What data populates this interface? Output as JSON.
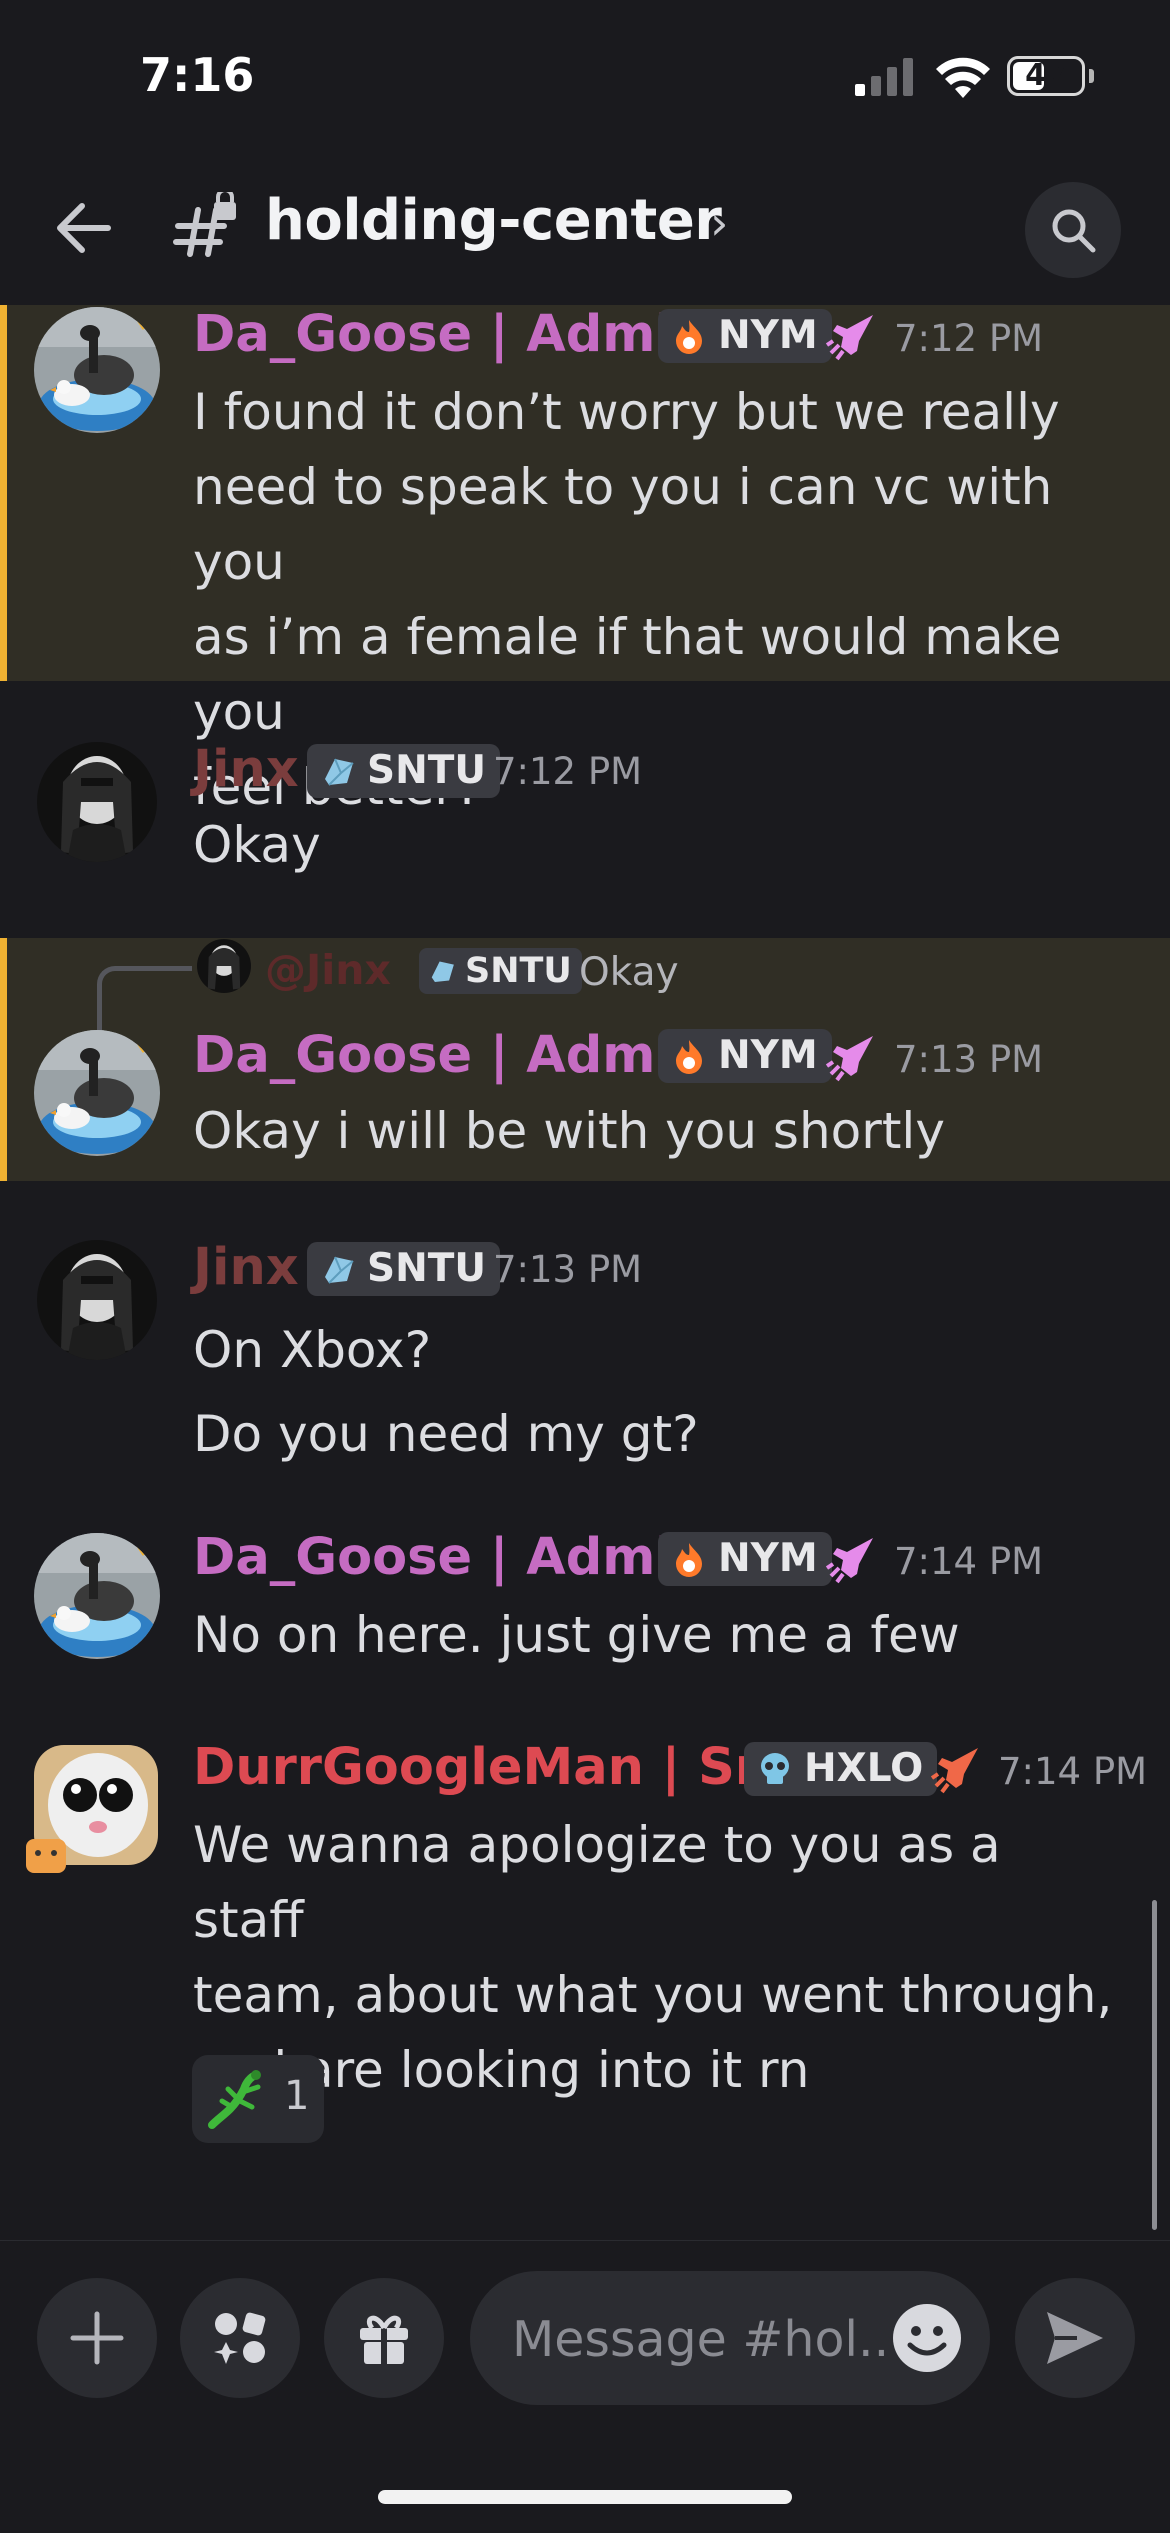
{
  "status_bar": {
    "time": "7:16",
    "battery": "47",
    "battery_level": 0.47
  },
  "header": {
    "channel": "holding-center",
    "chevron": "›"
  },
  "messages": [
    {
      "username": "Da_Goose | Admin",
      "tag": "NYM",
      "time": "7:12 PM",
      "lines": [
        "I found it don’t worry but we really",
        "need to speak to you i can vc with you",
        "as i’m a female if that would make you",
        "feel better?"
      ]
    },
    {
      "username": "Jinx",
      "tag": "SNTU",
      "time": "7:12 PM",
      "lines": [
        "Okay"
      ]
    },
    {
      "reply": {
        "username": "@Jinx",
        "tag": "SNTU",
        "text": "Okay"
      },
      "username": "Da_Goose | Admin",
      "tag": "NYM",
      "time": "7:13 PM",
      "lines": [
        "Okay i will be with you shortly"
      ]
    },
    {
      "username": "Jinx",
      "tag": "SNTU",
      "time": "7:13 PM",
      "lines": [
        "On Xbox?",
        "Do you need my gt?"
      ]
    },
    {
      "username": "Da_Goose | Admin",
      "tag": "NYM",
      "time": "7:14 PM",
      "lines": [
        "No on here. just give me a few"
      ]
    },
    {
      "username": "DurrGoogleMan | Sr...",
      "tag": "HXLO",
      "time": "7:14 PM",
      "lines": [
        "We wanna apologize to you as a staff",
        "team, about what you went through,",
        "and are looking into it rn"
      ],
      "reaction": {
        "emoji": "lizard",
        "count": "1"
      }
    }
  ],
  "composer": {
    "placeholder": "Message #hol.."
  },
  "colors": {
    "highlight_bg": "#302e25",
    "highlight_bar": "#f0b232",
    "goose": "#c56cc2",
    "jinx": "#7b3d3d",
    "durr": "#dd4a52"
  },
  "icons": [
    "back-arrow-icon",
    "channel-hash-lock-icon",
    "search-icon",
    "flame-icon",
    "gem-icon",
    "skull-icon",
    "boost-rocket-icon",
    "plus-icon",
    "apps-icon",
    "gift-icon",
    "emoji-icon",
    "send-icon",
    "lizard-icon"
  ]
}
